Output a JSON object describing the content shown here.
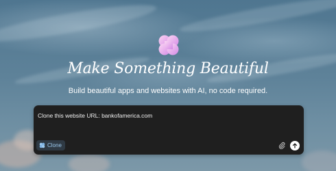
{
  "hero": {
    "title": "Make Something Beautiful",
    "subtitle": "Build beautiful apps and websites with AI, no code required."
  },
  "prompt": {
    "value": "Clone this website URL: bankofamerica.com"
  },
  "actions": {
    "clone_label": "Clone",
    "clone_icon": "clone-flower-icon",
    "attach_icon": "paperclip-icon",
    "send_icon": "arrow-up-icon"
  },
  "colors": {
    "logo_gradient": [
      "#f6c6ee",
      "#d98ee8"
    ],
    "clone_accent": "#9cc9ee",
    "prompt_bg": "#1f1f1f"
  }
}
